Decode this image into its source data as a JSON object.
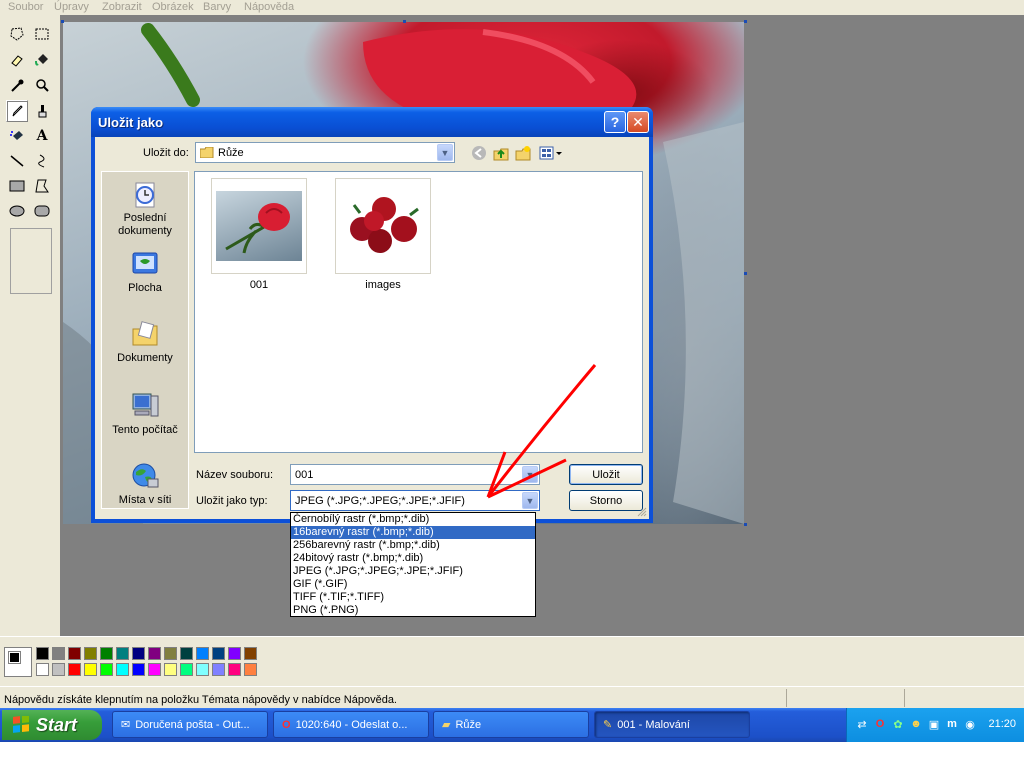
{
  "menubar": {
    "items": [
      "Soubor",
      "Úpravy",
      "Zobrazit",
      "Obrázek",
      "Barvy",
      "Nápověda"
    ]
  },
  "statusbar": {
    "text": "Nápovědu získáte klepnutím na položku Témata nápovědy v nabídce Nápověda."
  },
  "dialog": {
    "title": "Uložit jako",
    "help_button": "?",
    "close_button": "✕",
    "save_in_label": "Uložit do:",
    "save_in_value": "Růže",
    "places": [
      "Poslední dokumenty",
      "Plocha",
      "Dokumenty",
      "Tento počítač",
      "Místa v síti"
    ],
    "files": [
      "001",
      "images"
    ],
    "filename_label": "Název souboru:",
    "filename_value": "001",
    "filetype_label": "Uložit jako typ:",
    "filetype_value": "JPEG (*.JPG;*.JPEG;*.JPE;*.JFIF)",
    "save_button": "Uložit",
    "cancel_button": "Storno",
    "filetype_options": [
      "Černobílý rastr (*.bmp;*.dib)",
      "16barevný rastr (*.bmp;*.dib)",
      "256barevný rastr (*.bmp;*.dib)",
      "24bitový rastr (*.bmp;*.dib)",
      "JPEG (*.JPG;*.JPEG;*.JPE;*.JFIF)",
      "GIF (*.GIF)",
      "TIFF (*.TIF;*.TIFF)",
      "PNG (*.PNG)"
    ],
    "filetype_highlighted_index": 1
  },
  "taskbar": {
    "start_label": "Start",
    "tasks": [
      "Doručená pošta - Out...",
      "1020:640 - Odeslat o...",
      "Růže",
      "001 - Malování"
    ],
    "clock": "21:20"
  },
  "colors": {
    "titlebar": "#0a4fd3",
    "selection": "#316ac5",
    "annotation_arrow": "#ff0000",
    "palette": [
      "#000000",
      "#808080",
      "#800000",
      "#808000",
      "#008000",
      "#008080",
      "#000080",
      "#800080",
      "#808040",
      "#004040",
      "#0080ff",
      "#004080",
      "#8000ff",
      "#804000",
      "#ffffff",
      "#c0c0c0",
      "#ff0000",
      "#ffff00",
      "#00ff00",
      "#00ffff",
      "#0000ff",
      "#ff00ff",
      "#ffff80",
      "#00ff80",
      "#80ffff",
      "#8080ff",
      "#ff0080",
      "#ff8040"
    ]
  }
}
